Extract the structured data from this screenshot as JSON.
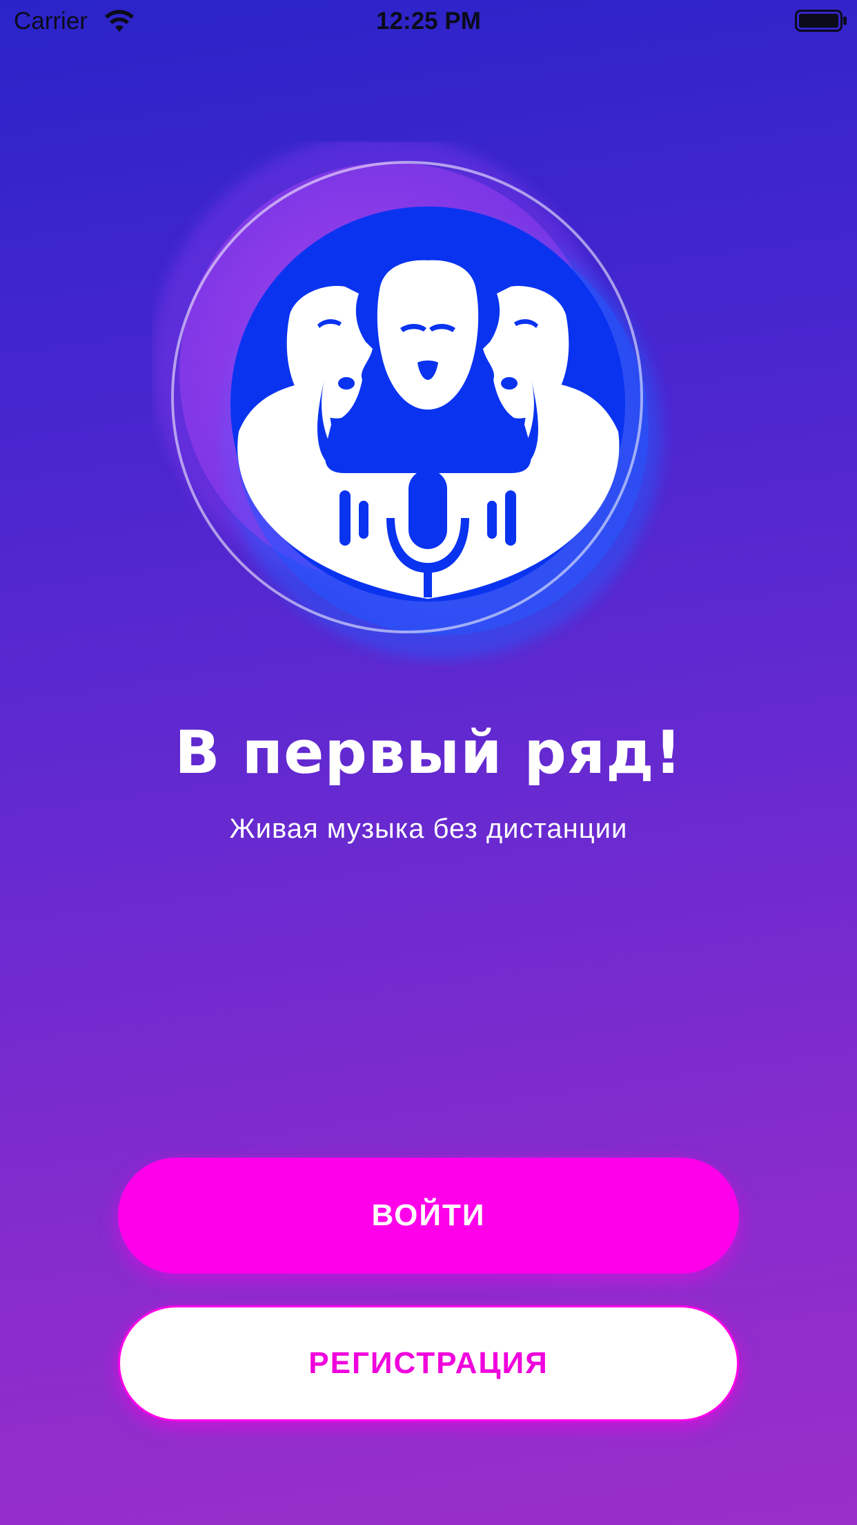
{
  "status_bar": {
    "carrier": "Carrier",
    "time": "12:25 PM",
    "icons": [
      "wifi-icon",
      "battery-icon"
    ]
  },
  "logo": {
    "icon": "singers-microphone-logo",
    "colors": {
      "circle": "#0a33f0",
      "ring_pink": "#b044f0",
      "ring_blue": "#1e5cff"
    }
  },
  "welcome": {
    "title": "В первый ряд!",
    "subtitle": "Живая музыка без дистанции"
  },
  "actions": {
    "login_label": "ВОЙТИ",
    "register_label": "РЕГИСТРАЦИЯ"
  },
  "colors": {
    "background_top": "#2a24c8",
    "background_bottom": "#9a2ec9",
    "accent": "#ff00ea",
    "text_light": "#ffffff"
  }
}
